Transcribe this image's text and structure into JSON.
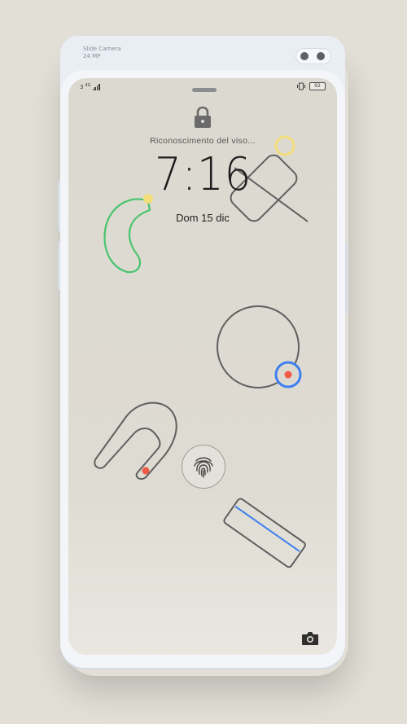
{
  "hardware": {
    "slide_camera_line1": "Slide Camera",
    "slide_camera_line2": "24 MP"
  },
  "status_bar": {
    "sim_label": "3",
    "network_type": "4G",
    "battery_percent": "92"
  },
  "lock_screen": {
    "unlock_status": "Riconoscimento del viso...",
    "time": "7:16",
    "date": "Dom 15 dic"
  },
  "icons": {
    "lock": "lock-icon",
    "fingerprint": "fingerprint-icon",
    "camera": "camera-icon",
    "vibrate": "vibrate-icon",
    "signal": "signal-icon"
  },
  "colors": {
    "wallpaper": "#dcd9d0",
    "line": "#5f5f5f",
    "green": "#48c46e",
    "yellow": "#f3dd7a",
    "blue": "#3d7ff0",
    "red": "#ef5a45"
  }
}
